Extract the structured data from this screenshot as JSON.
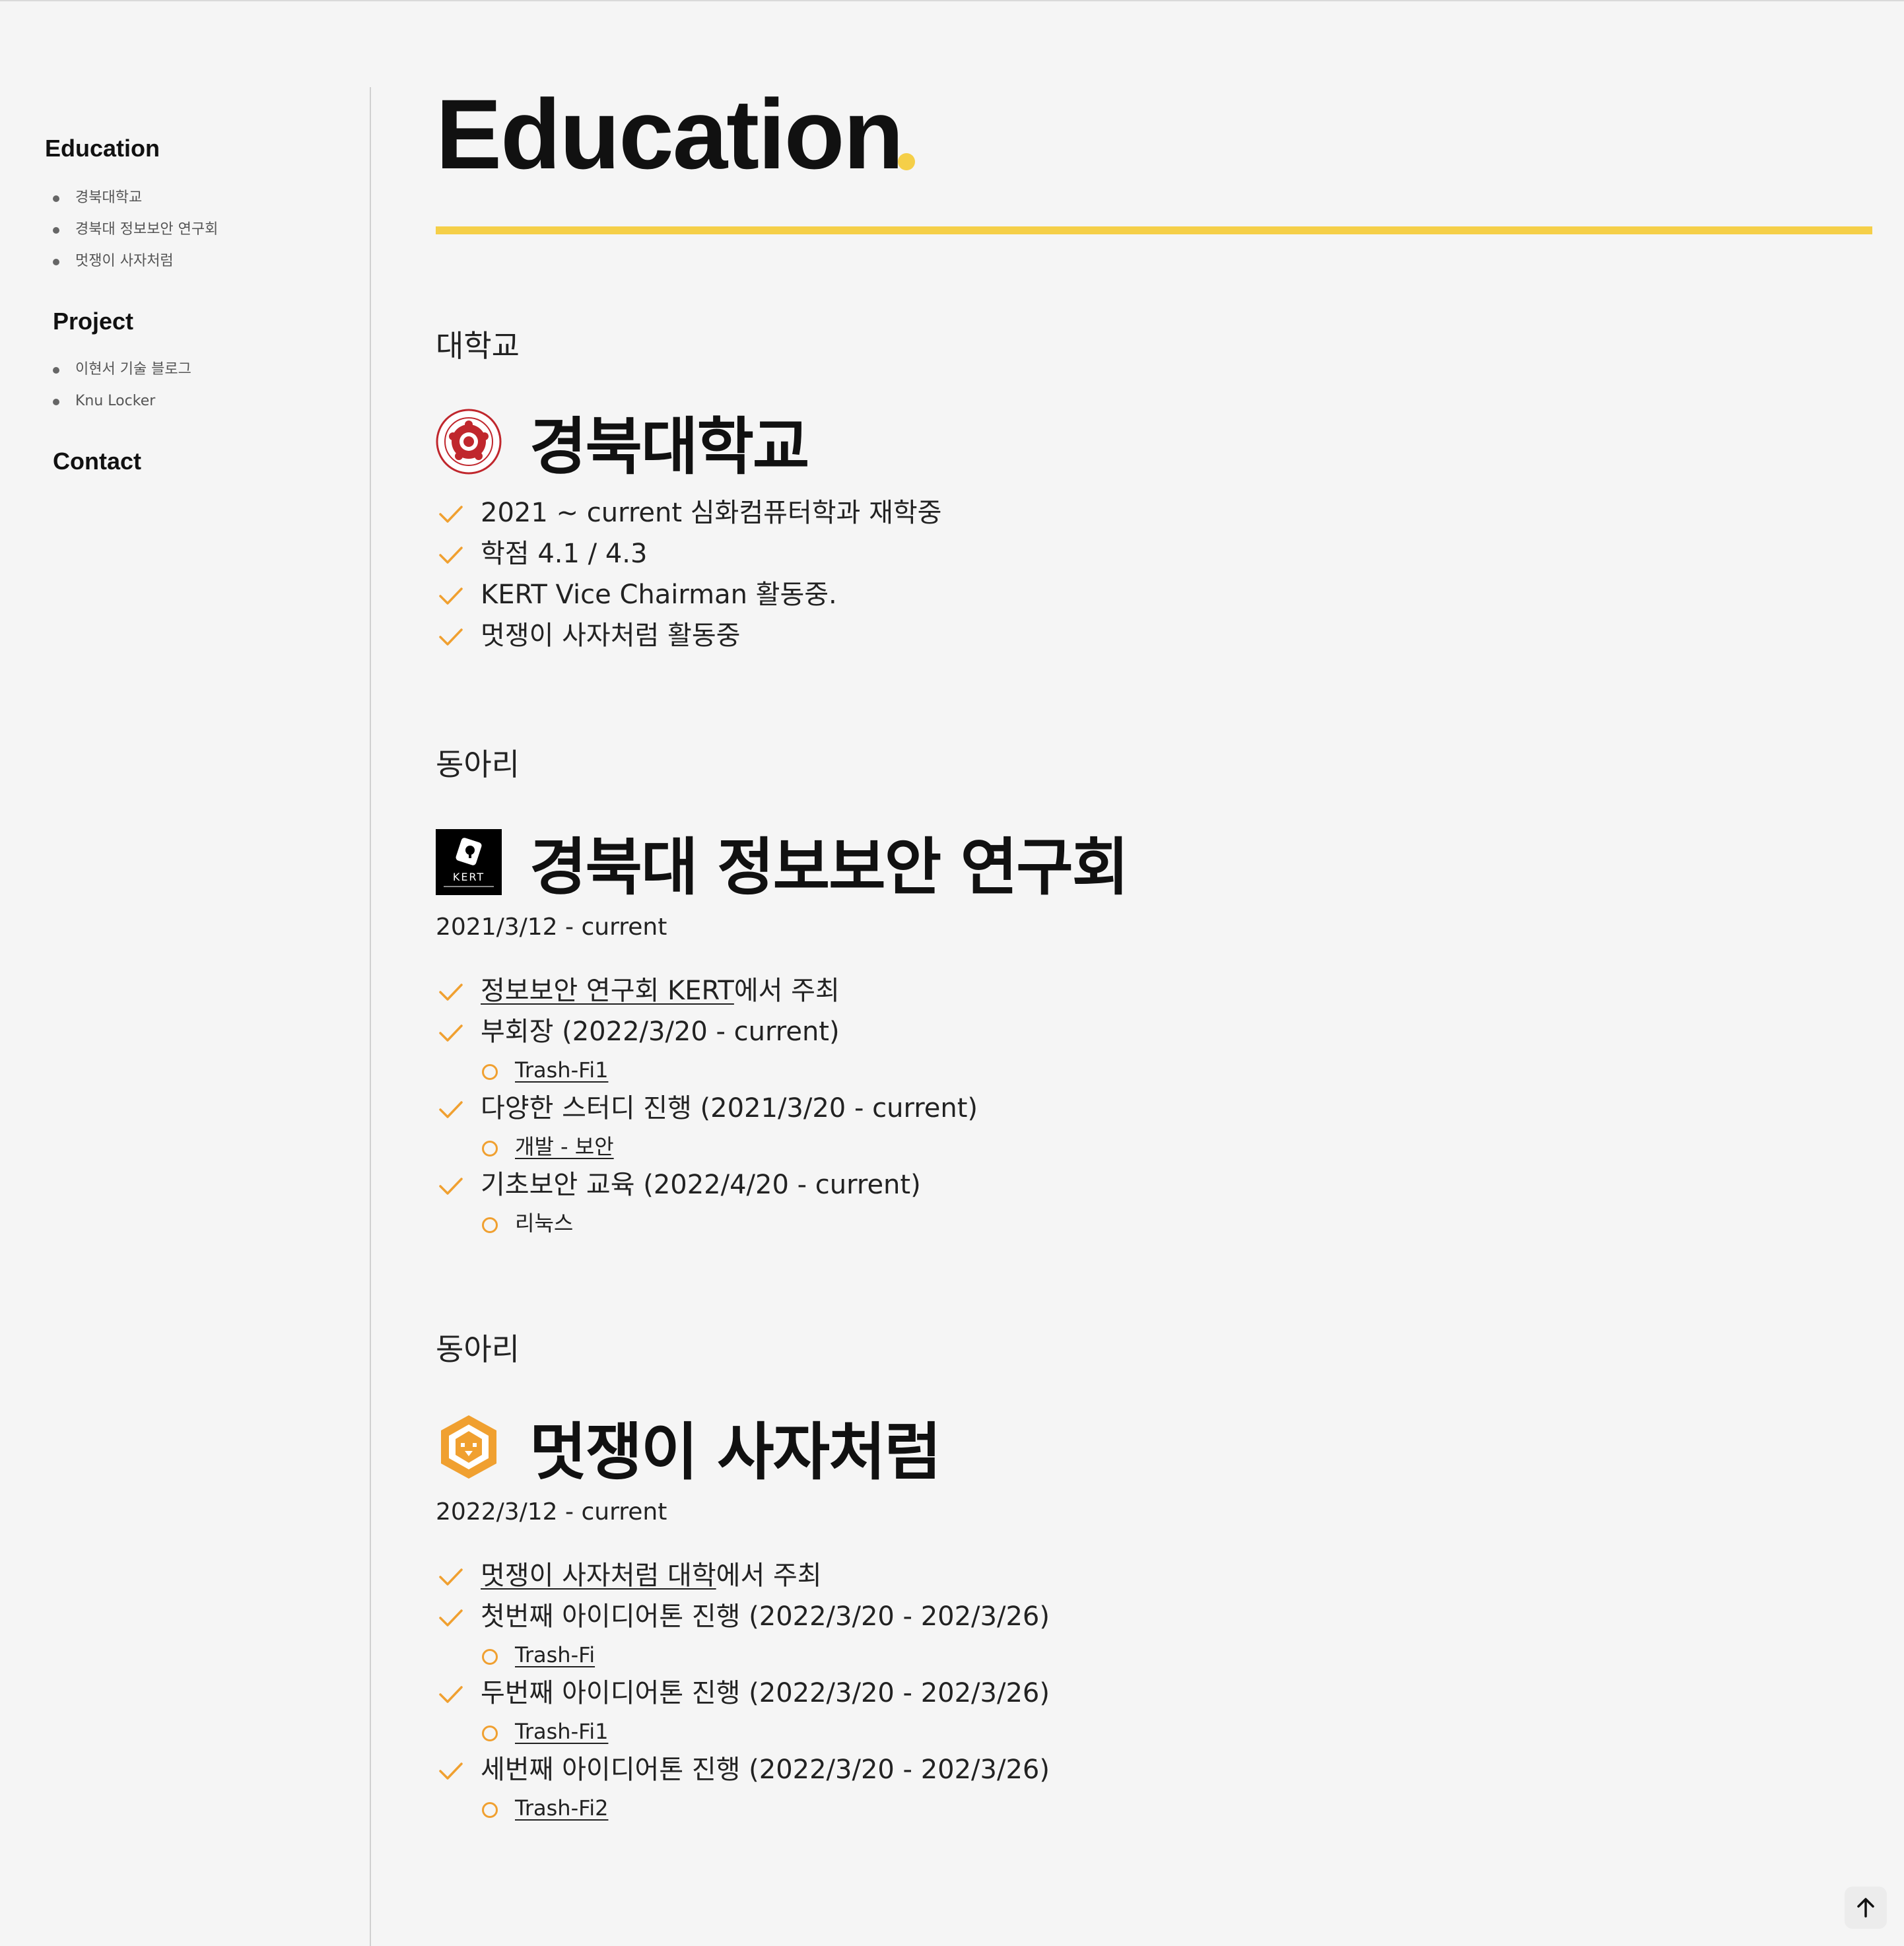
{
  "sidebar": {
    "sections": [
      {
        "title": "Education",
        "items": [
          "경북대학교",
          "경북대 정보보안 연구회",
          "멋쟁이 사자처럼"
        ]
      },
      {
        "title": "Project",
        "items": [
          "이현서 기술 블로그",
          "Knu Locker"
        ]
      },
      {
        "title": "Contact",
        "items": []
      }
    ]
  },
  "page": {
    "title": "Education",
    "accent": "#f5cf48"
  },
  "blocks": [
    {
      "category": "대학교",
      "name": "경북대학교",
      "logo": "knu-emblem-icon",
      "period": "",
      "items": [
        {
          "text": "2021 ~ current 심화컴퓨터학과 재학중",
          "subs": []
        },
        {
          "text": "학점 4.1 / 4.3",
          "subs": []
        },
        {
          "text": "KERT Vice Chairman 활동중.",
          "subs": []
        },
        {
          "text": "멋쟁이 사자처럼 활동중",
          "subs": []
        }
      ]
    },
    {
      "category": "동아리",
      "name": "경북대 정보보안 연구회",
      "logo": "kert-logo-icon",
      "logo_text": "KERT",
      "period": "2021/3/12 - current",
      "items": [
        {
          "link": "정보보안 연구회 KERT",
          "text": "에서 주최",
          "subs": []
        },
        {
          "text": "부회장 (2022/3/20 - current)",
          "subs": [
            "Trash-Fi1"
          ]
        },
        {
          "text": "다양한 스터디 진행 (2021/3/20 - current)",
          "subs": [
            "개발 - 보안"
          ]
        },
        {
          "text": "기초보안 교육 (2022/4/20 - current)",
          "subs": [
            "리눅스"
          ]
        }
      ]
    },
    {
      "category": "동아리",
      "name": "멋쟁이 사자처럼",
      "logo": "likelion-logo-icon",
      "period": "2022/3/12 - current",
      "items": [
        {
          "link": "멋쟁이 사자처럼 대학",
          "text": "에서 주최",
          "subs": []
        },
        {
          "text": "첫번째 아이디어톤 진행 (2022/3/20 - 202/3/26)",
          "subs": [
            "Trash-Fi"
          ]
        },
        {
          "text": "두번째 아이디어톤 진행 (2022/3/20 - 202/3/26)",
          "subs": [
            "Trash-Fi1"
          ]
        },
        {
          "text": "세번째 아이디어톤 진행 (2022/3/20 - 202/3/26)",
          "subs": [
            "Trash-Fi2"
          ]
        }
      ]
    }
  ],
  "colors": {
    "check": "#f0a030",
    "ring": "#f0a030"
  },
  "icons": {
    "check": "check-icon",
    "sub_bullet": "circle-icon",
    "scroll_top": "arrow-up-icon"
  }
}
